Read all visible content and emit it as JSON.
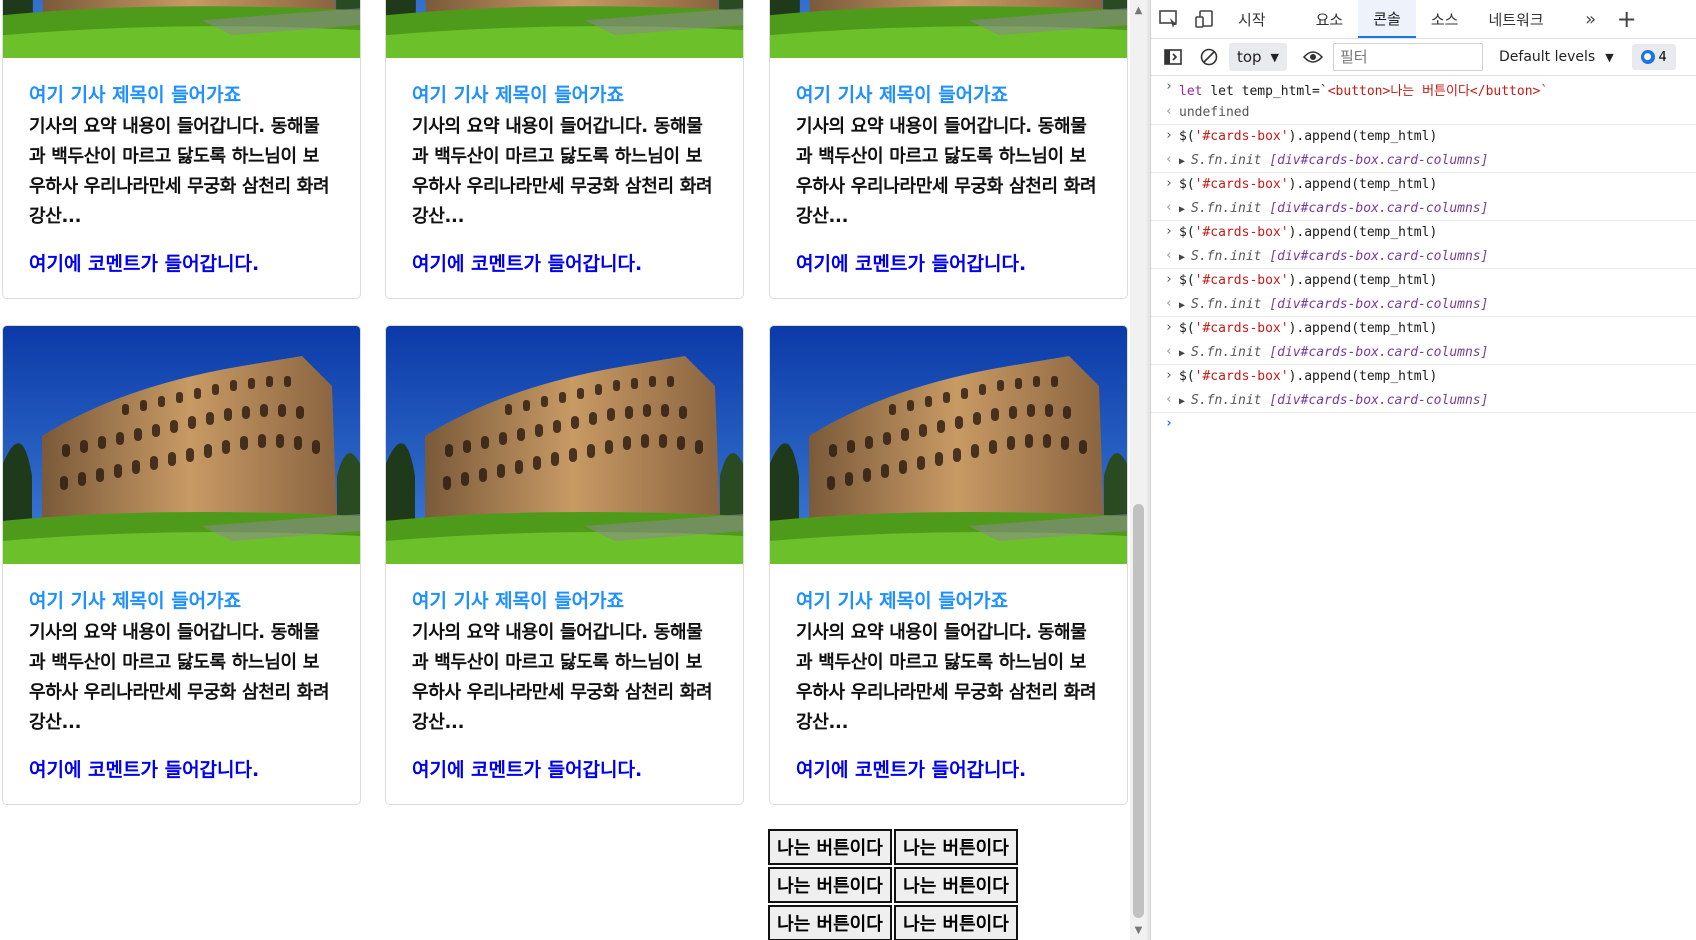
{
  "cards": [
    {
      "title": "여기 기사 제목이 들어가죠",
      "text": "기사의 요약 내용이 들어갑니다. 동해물과 백두산이 마르고 닳도록 하느님이 보우하사 우리나라만세 무궁화 삼천리 화려강산...",
      "comment": "여기에 코멘트가 들어갑니다."
    },
    {
      "title": "여기 기사 제목이 들어가죠",
      "text": "기사의 요약 내용이 들어갑니다. 동해물과 백두산이 마르고 닳도록 하느님이 보우하사 우리나라만세 무궁화 삼천리 화려강산...",
      "comment": "여기에 코멘트가 들어갑니다."
    },
    {
      "title": "여기 기사 제목이 들어가죠",
      "text": "기사의 요약 내용이 들어갑니다. 동해물과 백두산이 마르고 닳도록 하느님이 보우하사 우리나라만세 무궁화 삼천리 화려강산...",
      "comment": "여기에 코멘트가 들어갑니다."
    },
    {
      "title": "여기 기사 제목이 들어가죠",
      "text": "기사의 요약 내용이 들어갑니다. 동해물과 백두산이 마르고 닳도록 하느님이 보우하사 우리나라만세 무궁화 삼천리 화려강산...",
      "comment": "여기에 코멘트가 들어갑니다."
    },
    {
      "title": "여기 기사 제목이 들어가죠",
      "text": "기사의 요약 내용이 들어갑니다. 동해물과 백두산이 마르고 닳도록 하느님이 보우하사 우리나라만세 무궁화 삼천리 화려강산...",
      "comment": "여기에 코멘트가 들어갑니다."
    },
    {
      "title": "여기 기사 제목이 들어가죠",
      "text": "기사의 요약 내용이 들어갑니다. 동해물과 백두산이 마르고 닳도록 하느님이 보우하사 우리나라만세 무궁화 삼천리 화려강산...",
      "comment": "여기에 코멘트가 들어갑니다."
    }
  ],
  "buttons": [
    "나는 버튼이다",
    "나는 버튼이다",
    "나는 버튼이다",
    "나는 버튼이다",
    "나는 버튼이다",
    "나는 버튼이다"
  ],
  "devtools": {
    "tabs": [
      "시작",
      "요소",
      "콘솔",
      "소스",
      "네트워크"
    ],
    "active_tab": "콘솔",
    "context": "top",
    "filter_placeholder": "필터",
    "levels": "Default levels",
    "issues_count": "4",
    "console": {
      "line1_prefix": "let temp_html=`",
      "line1_str": "<button>나는 버튼이다</button>",
      "line1_suffix": "`",
      "line2": "undefined",
      "cmd_prefix": "$(",
      "cmd_str": "'#cards-box'",
      "cmd_suffix": ").append(temp_html)",
      "result_fn": "S.fn.init",
      "result_class": "[div#cards-box.card-columns]"
    }
  },
  "colors": {
    "title": "#1e90ff",
    "comment": "#0000ee",
    "accent": "#1a73e8"
  }
}
